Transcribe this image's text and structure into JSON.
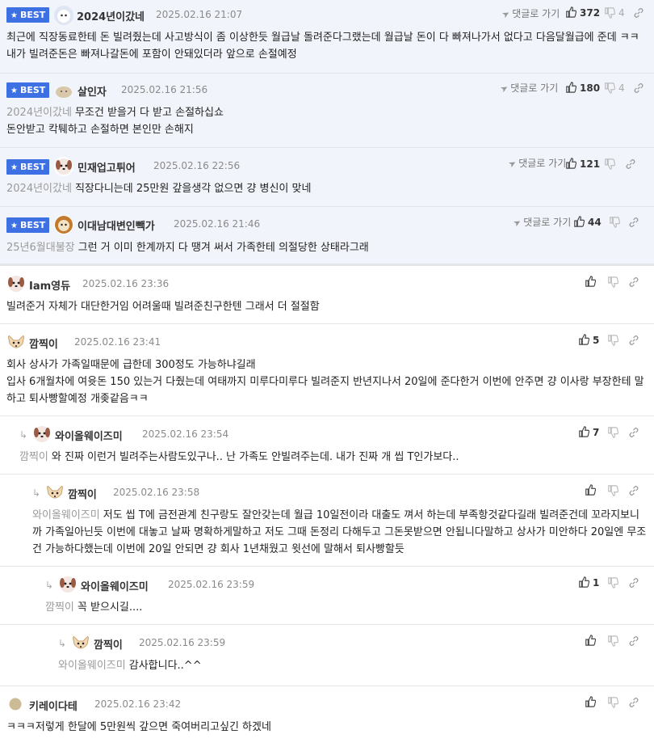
{
  "ui": {
    "best_label": "BEST",
    "reply_go_label": "댓글로 가기",
    "accent_color": "#3d71e3"
  },
  "comments": [
    {
      "best": true,
      "nick": "2024년이갔네",
      "date": "2025.02.16 21:07",
      "likes": "372",
      "dislikes": "4",
      "avatar": "ghost",
      "mention": "",
      "text": "최근에 직장동료한테 돈 빌려줬는데 사고방식이 좀 이상한듯 월급날 돌려준다그랬는데 월급날 돈이 다 빠져나가서 없다고 다음달월급에 준데 ㅋㅋ 내가 빌려준돈은 빠져나갈돈에 포함이 안돼있더라 앞으로 손절예정"
    },
    {
      "best": true,
      "nick": "살인자",
      "date": "2025.02.16 21:56",
      "likes": "180",
      "dislikes": "4",
      "avatar": "dog",
      "mention": "2024년이갔네",
      "text": "무조건 받을거 다 받고 손절하십쇼\n돈안받고 칵퉤하고 손절하면 본인만 손해지"
    },
    {
      "best": true,
      "nick": "민재업고튀어",
      "date": "2025.02.16 22:56",
      "likes": "121",
      "dislikes": "",
      "avatar": "pup",
      "mention": "2024년이갔네",
      "text": "직장다니는데 25만원 갚을생각 없으면 걍 병신이 맞네"
    },
    {
      "best": true,
      "nick": "이대남대변인빽가",
      "date": "2025.02.16 21:46",
      "likes": "44",
      "dislikes": "",
      "avatar": "lion",
      "mention": "25년6월대불장",
      "text": "그런 거 이미 한계까지 다 땡겨 써서 가족한테 의절당한 상태라그래"
    },
    {
      "best": false,
      "nick": "Iam영듀",
      "date": "2025.02.16 23:36",
      "likes": "",
      "avatar": "pup",
      "mention": "",
      "text": "빌려준거 자체가 대단한거임 어려울때 빌려준친구한텐 그래서 더 절절함"
    },
    {
      "best": false,
      "nick": "깜찍이",
      "date": "2025.02.16 23:41",
      "likes": "5",
      "avatar": "fox",
      "mention": "",
      "text": "회사 상사가 가족일때문에 급한데 300정도 가능하냐길래\n입사 6개월차에 여윳돈 150 있는거 다줬는데 여태까지 미루다미루다 빌려준지 반년지나서 20일에 준다한거 이번에 안주면 걍 이사랑 부장한테 말하고 퇴사빵할예정 개좆같음ㅋㅋ"
    },
    {
      "best": false,
      "nick": "와이올웨이즈미",
      "date": "2025.02.16 23:54",
      "likes": "7",
      "avatar": "pup",
      "mention": "깜찍이",
      "text": "와 진짜 이런거 빌려주는사람도있구나.. 난 가족도 안빌려주는데. 내가 진짜 개 씹 T인가보다.."
    },
    {
      "best": false,
      "nick": "깜찍이",
      "date": "2025.02.16 23:58",
      "likes": "",
      "avatar": "fox",
      "mention": "와이올웨이즈미",
      "text": "저도 씹 T에 금전관계 친구랑도 잘안갖는데 월급 10일전이라 대출도 껴서 하는데 부족항것같다길래 빌려준건데 꼬라지보니까 가족일아닌듯 이번에 대놓고 날짜 명확하게말하고 저도 그때 돈정리 다해두고 그돈못받으면 안됩니다말하고 상사가 미안하다 20일엔 무조건 가능하다했는데 이번에 20일 안되면 걍 회사 1년채웠고 윗선에 말해서 퇴사빵할듯"
    },
    {
      "best": false,
      "nick": "와이올웨이즈미",
      "date": "2025.02.16 23:59",
      "likes": "1",
      "avatar": "pup",
      "mention": "깜찍이",
      "text": "꼭 받으시길...."
    },
    {
      "best": false,
      "nick": "깜찍이",
      "date": "2025.02.16 23:59",
      "likes": "",
      "avatar": "fox",
      "mention": "와이올웨이즈미",
      "text": "감사합니다..^^"
    },
    {
      "best": false,
      "nick": "키레이다테",
      "date": "2025.02.16 23:42",
      "likes": "",
      "avatar": "dot",
      "mention": "",
      "text": "ㅋㅋㅋ저렇게 한달에 5만원씩 갚으면 죽여버리고싶긴 하겠네"
    }
  ]
}
